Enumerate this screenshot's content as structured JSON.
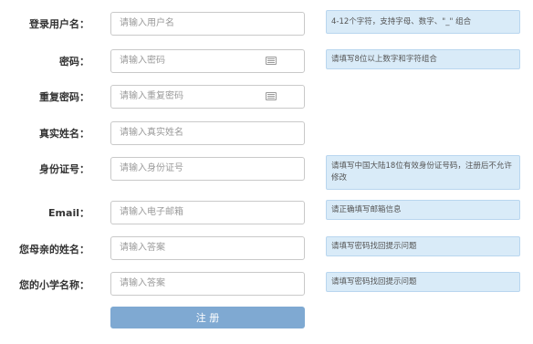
{
  "fields": [
    {
      "label": "登录用户名：",
      "placeholder": "请输入用户名",
      "hint": "4-12个字符，支持字母、数字、\"_\" 组合",
      "icon": ""
    },
    {
      "label": "密码：",
      "placeholder": "请输入密码",
      "hint": "请填写8位以上数字和字符组合",
      "icon": "keyboard-icon"
    },
    {
      "label": "重复密码：",
      "placeholder": "请输入重复密码",
      "hint": "",
      "icon": "keyboard-icon"
    },
    {
      "label": "真实姓名：",
      "placeholder": "请输入真实姓名",
      "hint": "",
      "icon": ""
    },
    {
      "label": "身份证号：",
      "placeholder": "请输入身份证号",
      "hint": "请填写中国大陆18位有效身份证号码，注册后不允许修改",
      "icon": ""
    },
    {
      "label": "Email：",
      "placeholder": "请输入电子邮箱",
      "hint": "请正确填写邮箱信息",
      "icon": ""
    },
    {
      "label": "您母亲的姓名：",
      "placeholder": "请输入答案",
      "hint": "请填写密码找回提示问题",
      "icon": ""
    },
    {
      "label": "您的小学名称：",
      "placeholder": "请输入答案",
      "hint": "请填写密码找回提示问题",
      "icon": ""
    }
  ],
  "submit_label": "注 册"
}
